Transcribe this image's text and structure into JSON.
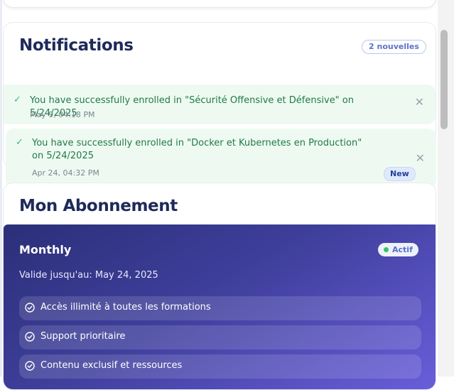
{
  "notifications": {
    "title": "Notifications",
    "count_badge": "2 nouvelles",
    "items": [
      {
        "message": "You have successfully enrolled in \"Sécurité Offensive et Défensive\" on 5/24/2025",
        "time": "May 9, 04:18 PM",
        "icon": "check-icon",
        "is_new": false
      },
      {
        "message": "You have successfully enrolled in \"Docker et Kubernetes en Production\" on 5/24/2025",
        "time": "Apr 24, 04:32 PM",
        "icon": "check-icon",
        "is_new": true,
        "new_label": "New"
      }
    ]
  },
  "subscription": {
    "title": "Mon Abonnement",
    "plan": {
      "name": "Monthly",
      "status": "Actif",
      "valid_until": "Valide jusqu'au: May 24, 2025",
      "features": [
        "Accès illimité à toutes les formations",
        "Support prioritaire",
        "Contenu exclusif et ressources"
      ]
    }
  },
  "colors": {
    "notification_bg": "#eefaf1",
    "notification_text": "#217a45",
    "heading": "#1e2a5a",
    "plan_gradient_start": "#2b2f78",
    "plan_gradient_end": "#6a5fdc",
    "status_dot": "#35c26a"
  }
}
